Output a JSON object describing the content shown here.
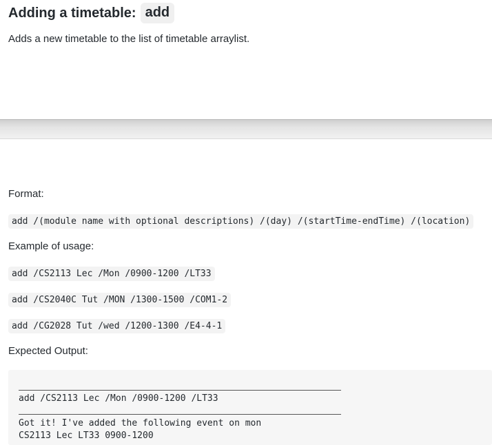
{
  "section": {
    "title": "Adding a timetable:",
    "command": "add",
    "description": "Adds a new timetable to the list of timetable arraylist."
  },
  "format": {
    "label": "Format:",
    "syntax": "add /(module name with optional descriptions) /(day) /(startTime-endTime) /(location)"
  },
  "examples": {
    "label": "Example of usage:",
    "items": [
      "add /CS2113 Lec /Mon /0900-1200 /LT33",
      "add /CS2040C Tut /MON /1300-1500 /COM1-2",
      "add /CG2028 Tut /wed /1200-1300 /E4-4-1"
    ]
  },
  "output": {
    "label": "Expected Output:",
    "lines": [
      "add /CS2113 Lec /Mon /0900-1200 /LT33",
      "Got it! I've added the following event on mon",
      "CS2113 Lec LT33 0900-1200"
    ]
  }
}
